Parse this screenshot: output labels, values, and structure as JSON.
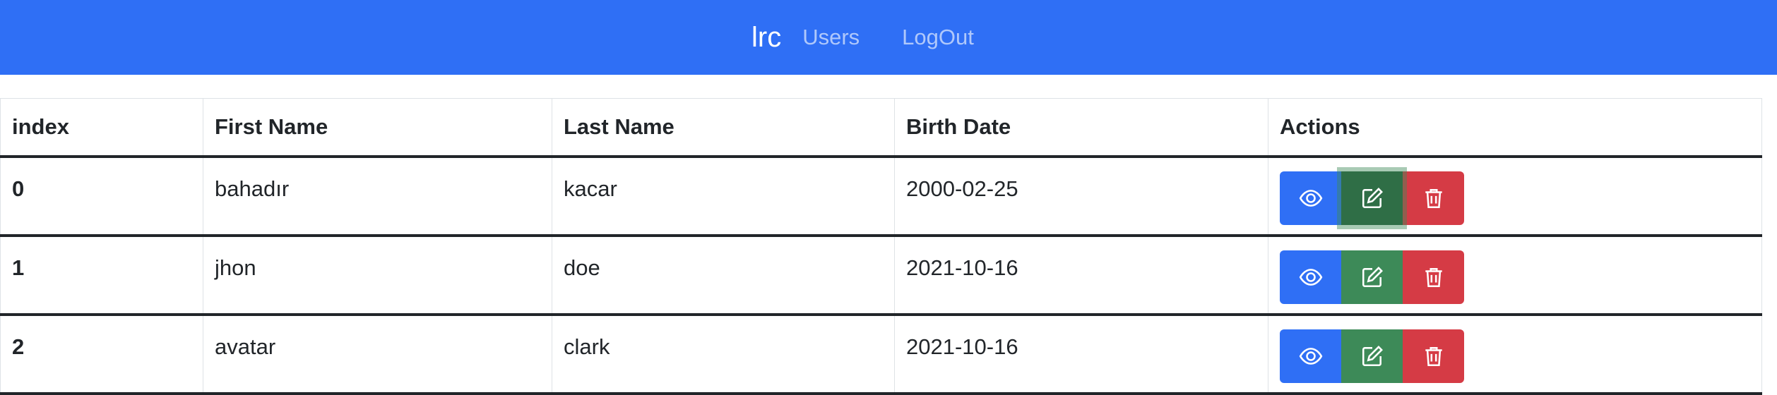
{
  "nav": {
    "brand": "lrc",
    "links": [
      "Users",
      "LogOut"
    ]
  },
  "table": {
    "headers": [
      "index",
      "First Name",
      "Last Name",
      "Birth Date",
      "Actions"
    ],
    "rows": [
      {
        "index": "0",
        "first": "bahadır",
        "last": "kacar",
        "birth": "2000-02-25"
      },
      {
        "index": "1",
        "first": "jhon",
        "last": "doe",
        "birth": "2021-10-16"
      },
      {
        "index": "2",
        "first": "avatar",
        "last": "clark",
        "birth": "2021-10-16"
      }
    ]
  },
  "actions": {
    "icons": [
      "eye-icon",
      "pencil-square-icon",
      "trash-icon"
    ]
  },
  "colors": {
    "primary": "#2f6ff5",
    "success": "#3d8a58",
    "danger": "#d53b45"
  }
}
